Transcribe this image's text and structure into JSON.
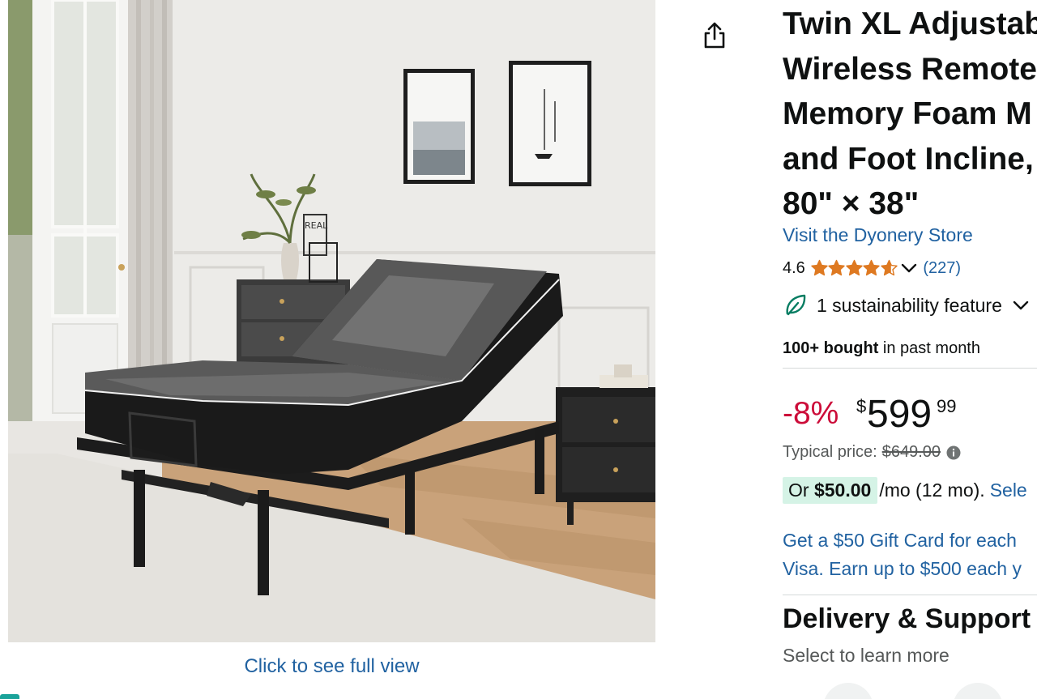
{
  "image": {
    "alt": "Twin XL adjustable bed frame with memory foam mattress in a bedroom",
    "full_view_link": "Click to see full view",
    "logo_text": "REAL"
  },
  "share": {
    "icon": "share-icon"
  },
  "product": {
    "title_lines": [
      "Twin XL Adjustable",
      "Wireless Remote,",
      "Memory Foam M",
      "and Foot Incline,",
      "80\" × 38\""
    ],
    "store_link": "Visit the Dyonery Store",
    "rating": {
      "value": "4.6",
      "stars_value": 4.6,
      "reviews": "(227)",
      "star_color": "#de7921"
    },
    "sustainability": "1 sustainability feature",
    "bought": {
      "count": "100+ bought",
      "suffix": "in past month"
    }
  },
  "price": {
    "discount": "-8%",
    "currency": "$",
    "whole": "599",
    "fraction": "99",
    "typical_label": "Typical price:",
    "typical_value": "$649.00",
    "monthly_prefix": "Or",
    "monthly_amount": "$50.00",
    "monthly_suffix": "/mo (12 mo).",
    "monthly_link": "Sele"
  },
  "promo": {
    "line1": "Get a $50 Gift Card for each",
    "line2": "Visa. Earn up to $500 each y"
  },
  "delivery": {
    "title": "Delivery & Support",
    "subtitle": "Select to learn more"
  },
  "colors": {
    "link": "#2162a1",
    "discount": "#cc0c39",
    "highlight": "#d5f3e6",
    "text": "#0f1111",
    "muted": "#565959"
  }
}
